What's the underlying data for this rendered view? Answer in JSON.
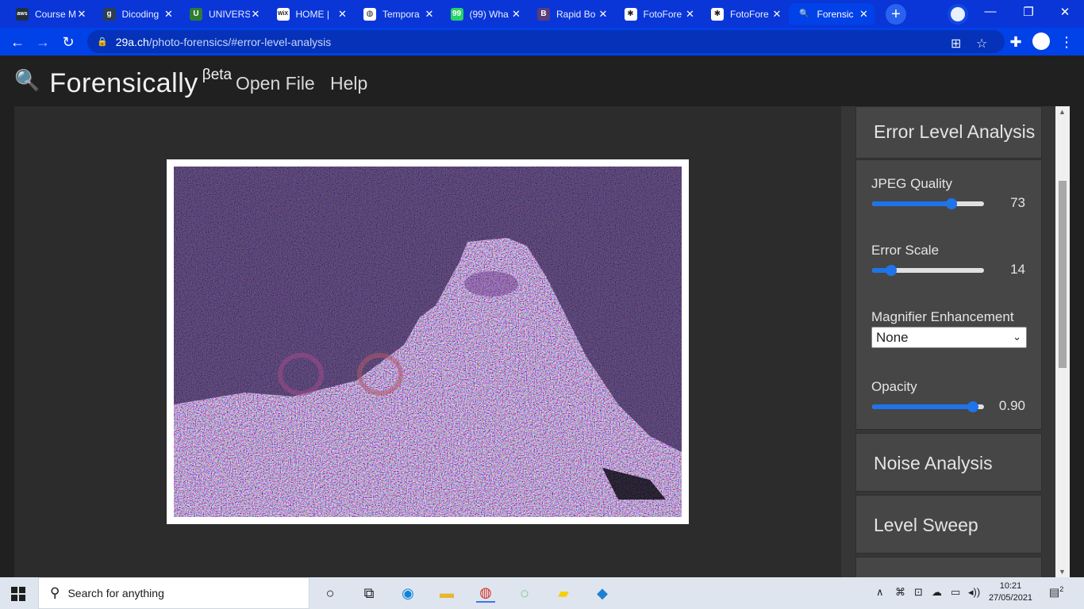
{
  "browser": {
    "tabs": [
      {
        "label": "Course M",
        "icon": "aws-icon",
        "color": "#232f3e",
        "glyph": "aws"
      },
      {
        "label": "Dicoding",
        "icon": "dicoding-icon",
        "color": "#2d3e50",
        "glyph": "g"
      },
      {
        "label": "UNIVERS",
        "icon": "university-crest-icon",
        "color": "#2e7d32",
        "glyph": "U"
      },
      {
        "label": "HOME |",
        "icon": "wix-icon",
        "color": "#ffffff",
        "glyph": "WiX"
      },
      {
        "label": "Tempora",
        "icon": "globe-icon",
        "color": "#ffffff",
        "glyph": "◍"
      },
      {
        "label": "(99) Wha",
        "icon": "whatsapp-icon",
        "color": "#25d366",
        "glyph": "99"
      },
      {
        "label": "Rapid Bo",
        "icon": "rapid-bootstrap-icon",
        "color": "#563d7c",
        "glyph": "B"
      },
      {
        "label": "FotoFore",
        "icon": "fotoforensics-icon",
        "color": "#ffffff",
        "glyph": "✱"
      },
      {
        "label": "FotoFore",
        "icon": "fotoforensics-icon",
        "color": "#ffffff",
        "glyph": "✱"
      },
      {
        "label": "Forensic",
        "icon": "magnifier-icon",
        "color": "#0041e8",
        "glyph": "🔍"
      }
    ],
    "close_glyph": "✕",
    "new_tab_glyph": "+",
    "url_host": "29a.ch",
    "url_path": "/photo-forensics/#error-level-analysis",
    "back": "←",
    "forward": "→",
    "reload": "↻",
    "minimize": "—",
    "restore": "❐",
    "close_window": "✕",
    "lock": "🔒",
    "translate": "⊞",
    "star": "☆",
    "extensions": "✚",
    "menu": "⋮"
  },
  "app": {
    "brand": "Forensically",
    "brand_sup": "βeta",
    "magnifier_glyph": "🔍",
    "nav": [
      "Open File",
      "Help"
    ]
  },
  "panel": {
    "ela_title": "Error Level Analysis",
    "jpeg_quality_label": "JPEG Quality",
    "jpeg_quality_value": "73",
    "jpeg_quality_fraction": 0.71,
    "error_scale_label": "Error Scale",
    "error_scale_value": "14",
    "error_scale_fraction": 0.17,
    "magnifier_label": "Magnifier Enhancement",
    "magnifier_value": "None",
    "opacity_label": "Opacity",
    "opacity_value": "0.90",
    "opacity_fraction": 0.9,
    "noise_title": "Noise Analysis",
    "sweep_title": "Level Sweep"
  },
  "scrollbar": {
    "up": "▲",
    "down": "▼"
  },
  "taskbar": {
    "search_placeholder": "Search for anything",
    "search_glyph": "⚲",
    "apps": [
      {
        "name": "cortana-icon",
        "glyph": "○",
        "color": "#1a1a1a"
      },
      {
        "name": "task-view-icon",
        "glyph": "⧉",
        "color": "#1a1a1a"
      },
      {
        "name": "edge-icon",
        "glyph": "◉",
        "color": "#0f83d8"
      },
      {
        "name": "file-explorer-icon",
        "glyph": "▬",
        "color": "#e8b630"
      },
      {
        "name": "chrome-icon",
        "glyph": "◍",
        "color": "#d93025"
      },
      {
        "name": "app-ring-icon",
        "glyph": "◌",
        "color": "#2bb24c"
      },
      {
        "name": "sticky-notes-icon",
        "glyph": "▰",
        "color": "#f5d000"
      },
      {
        "name": "vscode-icon",
        "glyph": "◆",
        "color": "#1f7fd1"
      }
    ],
    "tray": [
      "∧",
      "⌘",
      "⊡",
      "☁",
      "▭",
      "◂))"
    ],
    "time": "10:21",
    "date": "27/05/2021",
    "notifications": "2"
  }
}
